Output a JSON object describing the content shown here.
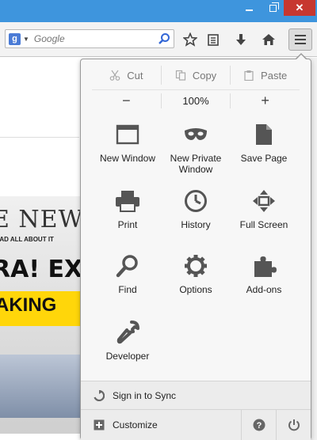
{
  "titlebar": {
    "minimize_icon": "minimize-icon",
    "restore_icon": "restore-icon",
    "close_label": "✕"
  },
  "toolbar": {
    "search": {
      "engine": "Google",
      "placeholder": "Google"
    },
    "icons": [
      "bookmark-star-icon",
      "reading-list-icon",
      "download-icon",
      "home-icon",
      "hamburger-menu-icon"
    ]
  },
  "menu": {
    "edit": [
      {
        "label": "Cut",
        "icon": "cut-icon"
      },
      {
        "label": "Copy",
        "icon": "copy-icon"
      },
      {
        "label": "Paste",
        "icon": "paste-icon"
      }
    ],
    "zoom": {
      "minus": "−",
      "level": "100%",
      "plus": "+"
    },
    "tiles": [
      {
        "label": "New Window",
        "icon": "new-window-icon"
      },
      {
        "label": "New Private\nWindow",
        "icon": "private-mask-icon"
      },
      {
        "label": "Save Page",
        "icon": "save-page-icon"
      },
      {
        "label": "Print",
        "icon": "print-icon"
      },
      {
        "label": "History",
        "icon": "history-clock-icon"
      },
      {
        "label": "Full Screen",
        "icon": "fullscreen-icon"
      },
      {
        "label": "Find",
        "icon": "find-magnifier-icon"
      },
      {
        "label": "Options",
        "icon": "options-gear-icon"
      },
      {
        "label": "Add-ons",
        "icon": "addons-puzzle-icon"
      },
      {
        "label": "Developer",
        "icon": "developer-wrench-icon"
      }
    ],
    "sync_label": "Sign in to Sync",
    "customize_label": "Customize"
  },
  "background": {
    "headline": "E NEWS",
    "subline": "EAD ALL ABOUT IT",
    "big": "RA! EX",
    "strip": "AKING"
  }
}
